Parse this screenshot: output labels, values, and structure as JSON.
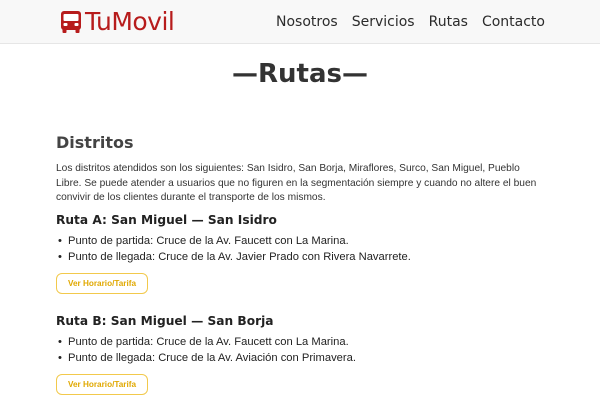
{
  "brand": {
    "name": "TuMovil",
    "logo_icon": "bus-icon",
    "color": "#b71c1c"
  },
  "nav": {
    "items": [
      "Nosotros",
      "Servicios",
      "Rutas",
      "Contacto"
    ]
  },
  "page": {
    "title": "—Rutas—"
  },
  "section": {
    "title": "Distritos",
    "description": "Los distritos atendidos son los siguientes: San Isidro, San Borja, Miraflores, Surco, San Miguel, Pueblo Libre. Se puede atender a usuarios que no figuren en la segmentación siempre y cuando no altere el buen convivir de los clientes durante el transporte de los mismos."
  },
  "routes": [
    {
      "title": "Ruta A: San Miguel — San Isidro",
      "points": [
        "Punto de partida: Cruce de la Av. Faucett con La Marina.",
        "Punto de llegada: Cruce de la Av. Javier Prado con Rivera Navarrete."
      ],
      "button": "Ver Horario/Tarifa"
    },
    {
      "title": "Ruta B: San Miguel — San Borja",
      "points": [
        "Punto de partida: Cruce de la Av. Faucett con La Marina.",
        "Punto de llegada: Cruce de la Av. Aviación con Primavera."
      ],
      "button": "Ver Horario/Tarifa"
    }
  ],
  "colors": {
    "accent": "#f2c94c",
    "button_text": "#e0a800",
    "navbar_bg": "#f8f8f8"
  }
}
